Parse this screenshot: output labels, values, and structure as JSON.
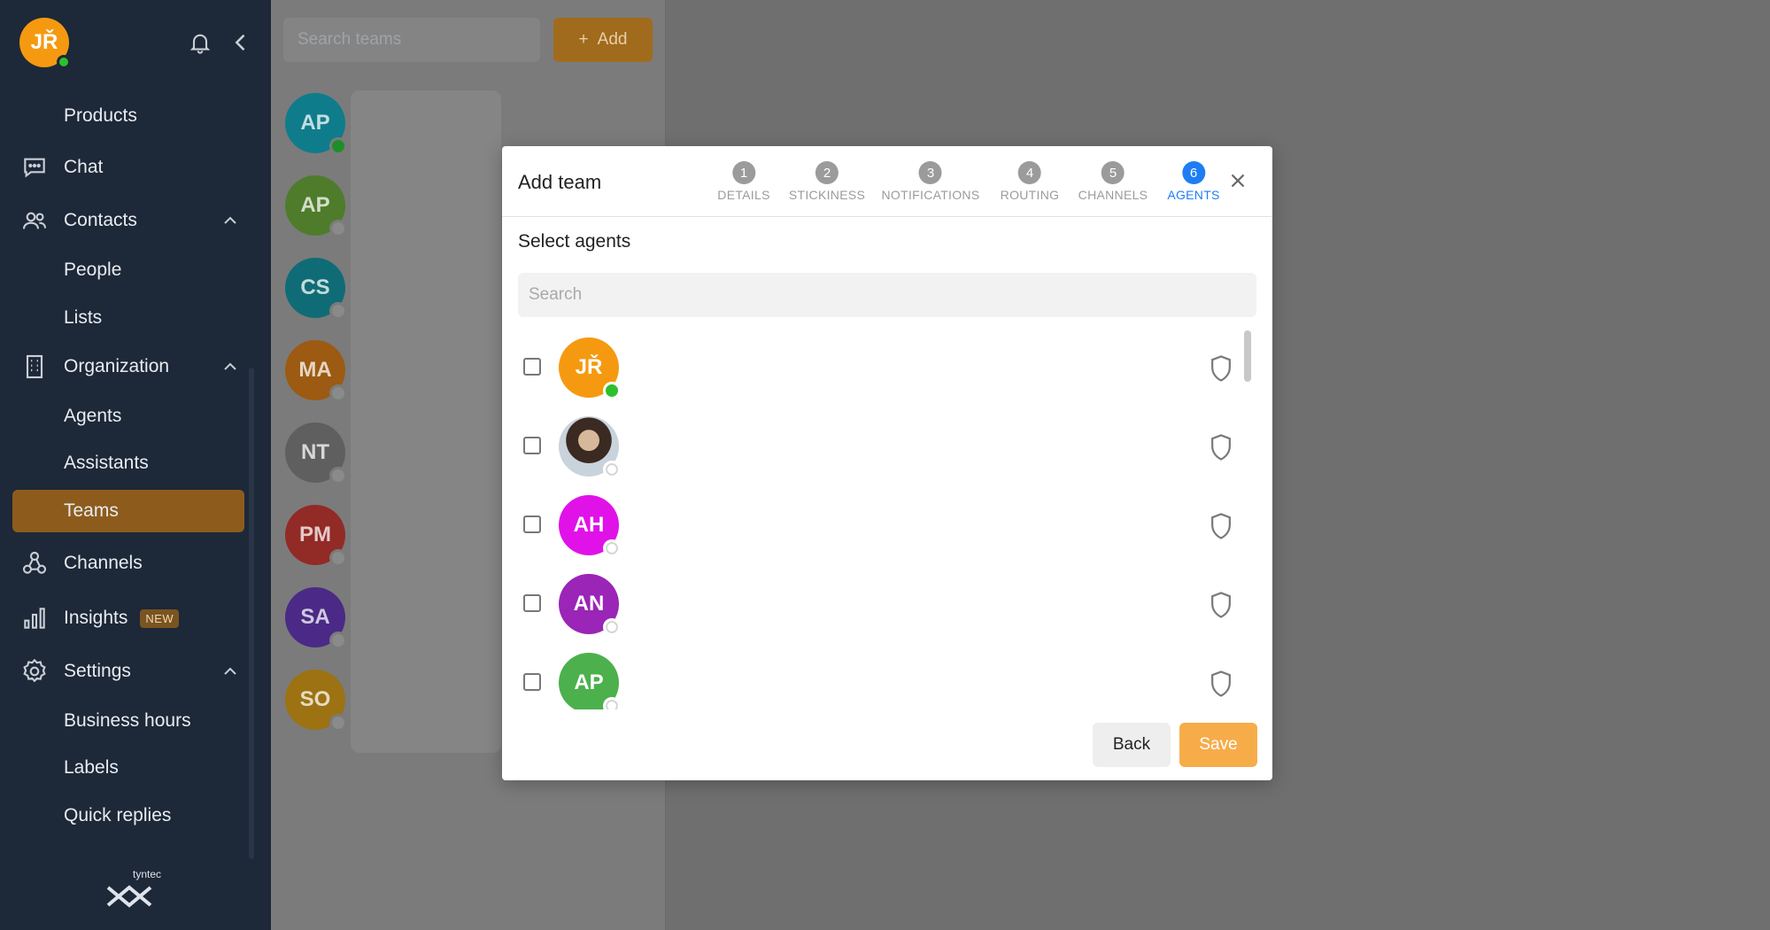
{
  "sidebar": {
    "user_initials": "JŘ",
    "items": {
      "products": "Products",
      "chat": "Chat",
      "contacts": "Contacts",
      "people": "People",
      "lists": "Lists",
      "organization": "Organization",
      "agents": "Agents",
      "assistants": "Assistants",
      "teams": "Teams",
      "channels": "Channels",
      "insights": "Insights",
      "insights_badge": "NEW",
      "settings": "Settings",
      "business_hours": "Business hours",
      "labels": "Labels",
      "quick_replies": "Quick replies"
    },
    "brand": "tyntec"
  },
  "teams_list": {
    "search_placeholder": "Search teams",
    "add_label": "Add",
    "avatars": [
      {
        "initials": "AP",
        "color": "#0f7c8c",
        "online": true
      },
      {
        "initials": "AP",
        "color": "#4e7c2b",
        "online": false
      },
      {
        "initials": "CS",
        "color": "#0f6c76",
        "online": false
      },
      {
        "initials": "MA",
        "color": "#9c5a12",
        "online": false
      },
      {
        "initials": "NT",
        "color": "#5f5f5f",
        "online": false
      },
      {
        "initials": "PM",
        "color": "#922a26",
        "online": false
      },
      {
        "initials": "SA",
        "color": "#4a2a86",
        "online": false
      },
      {
        "initials": "SO",
        "color": "#9c7212",
        "online": false
      }
    ]
  },
  "modal": {
    "title": "Add team",
    "steps": [
      {
        "num": "1",
        "label": "DETAILS"
      },
      {
        "num": "2",
        "label": "STICKINESS"
      },
      {
        "num": "3",
        "label": "NOTIFICATIONS"
      },
      {
        "num": "4",
        "label": "ROUTING"
      },
      {
        "num": "5",
        "label": "CHANNELS"
      },
      {
        "num": "6",
        "label": "AGENTS"
      }
    ],
    "active_step": 6,
    "section_title": "Select agents",
    "search_placeholder": "Search",
    "agents": [
      {
        "initials": "JŘ",
        "color": "#f59a10",
        "online": true
      },
      {
        "initials": "",
        "color": "#7a5a4a",
        "online": false
      },
      {
        "initials": "AH",
        "color": "#e012e8",
        "online": false
      },
      {
        "initials": "AN",
        "color": "#9a25b6",
        "online": false
      },
      {
        "initials": "AP",
        "color": "#4cb04c",
        "online": false
      }
    ],
    "back_label": "Back",
    "save_label": "Save"
  }
}
